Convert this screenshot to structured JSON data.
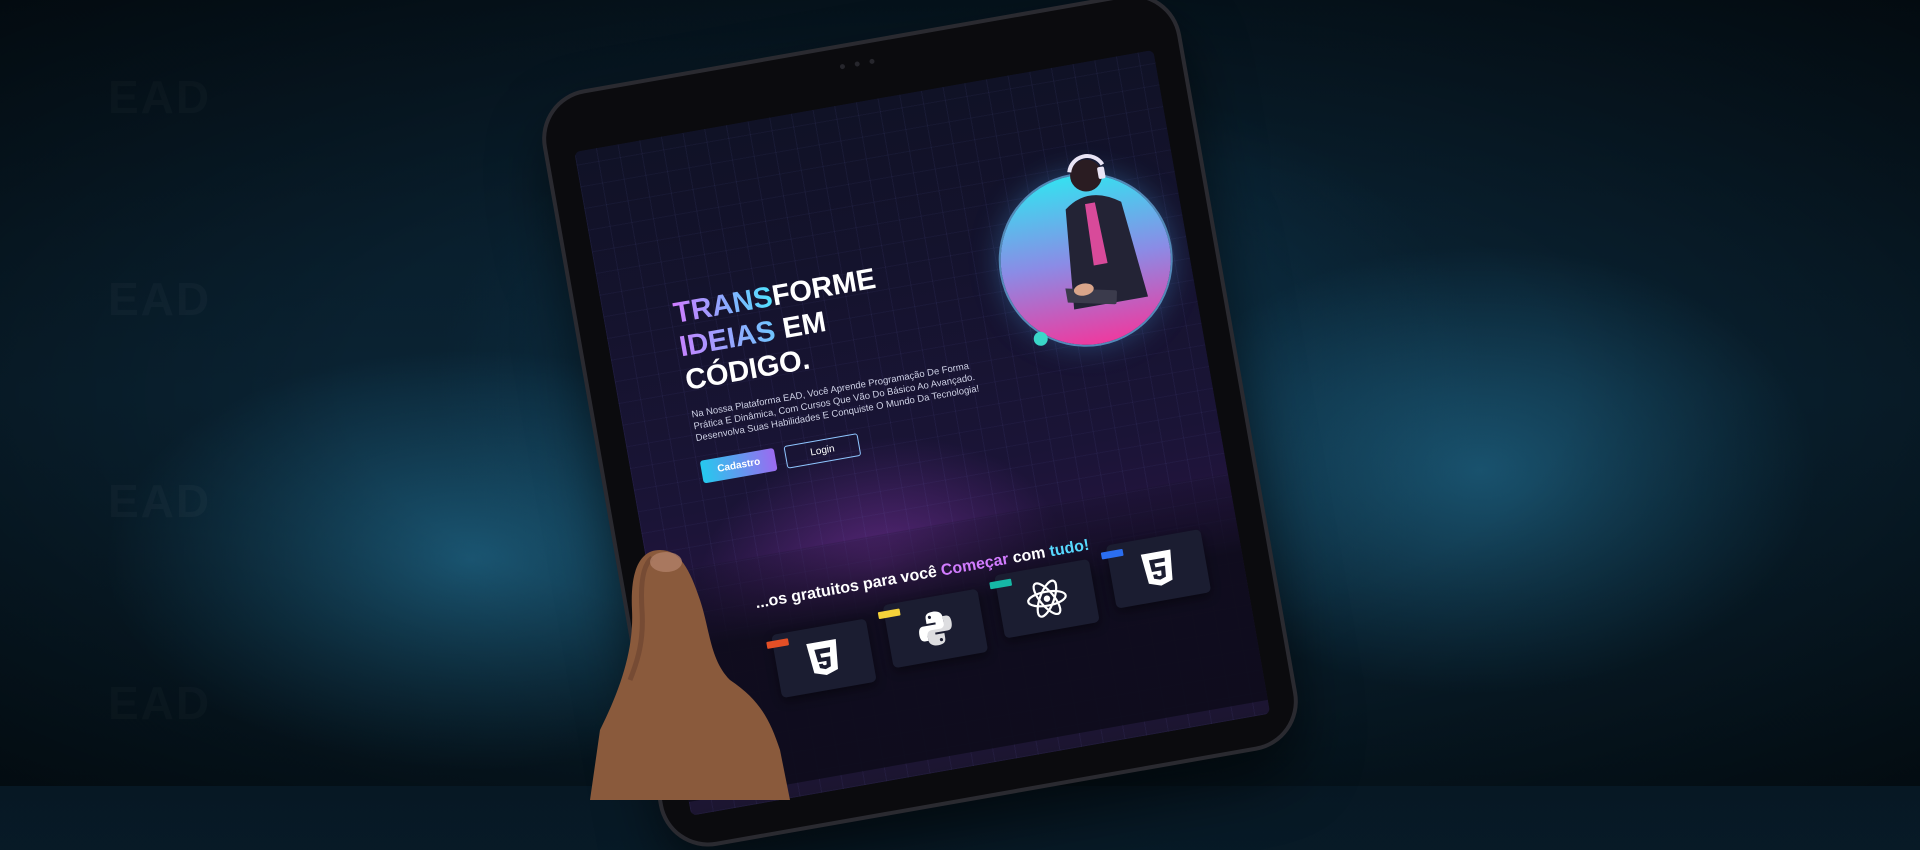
{
  "background": {
    "watermark": "EAD"
  },
  "hero": {
    "title_line1_highlight": "TRANS",
    "title_line1_rest": "FORME",
    "title_line2_highlight": "IDEIAS",
    "title_line2_rest": " EM CÓDIGO.",
    "description": "Na Nossa Plataforma EAD, Você Aprende Programação De Forma Prática E Dinâmica, Com Cursos Que Vão Do Básico Ao Avançado. Desenvolva Suas Habilidades E Conquiste O Mundo Da Tecnologia!",
    "signup_label": "Cadastro",
    "login_label": "Login"
  },
  "courses": {
    "title_prefix": "...os gratuitos para você ",
    "title_highlight1": "Começar",
    "title_mid": " com ",
    "title_highlight2": "tudo!",
    "items": [
      {
        "icon": "html5-icon",
        "tag_color": "#e34f26"
      },
      {
        "icon": "python-icon",
        "tag_color": "#f5d23a"
      },
      {
        "icon": "react-icon",
        "tag_color": "#16b8a6"
      },
      {
        "icon": "css3-icon",
        "tag_color": "#2b6ef0"
      }
    ]
  },
  "colors": {
    "accent_cyan": "#25c9ee",
    "accent_purple": "#9b6bf0",
    "accent_pink": "#ee3a9f"
  }
}
